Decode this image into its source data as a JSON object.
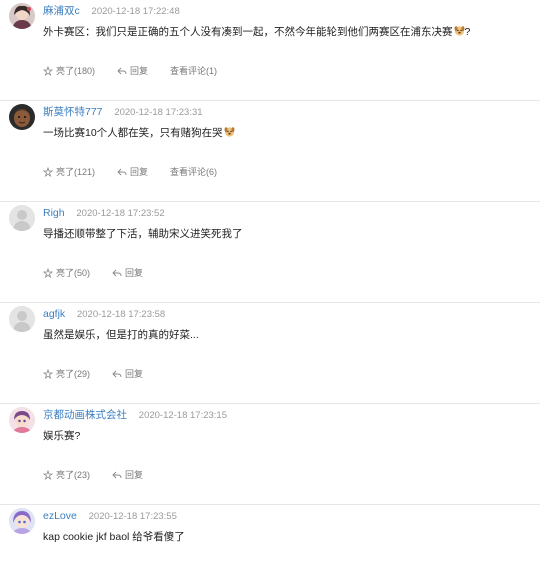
{
  "comments": [
    {
      "username": "麻浦双c",
      "time": "2020-12-18 17:22:48",
      "text": "外卡赛区：我们只是正确的五个人没有凑到一起，不然今年能轮到他们两赛区在浦东决赛",
      "suffix": "?",
      "emoji": true,
      "likes_label": "亮了(180)",
      "reply_label": "回复",
      "view_label": "查看评论(1)",
      "avatar": "girl-avatar"
    },
    {
      "username": "斯莫怀特777",
      "time": "2020-12-18 17:23:31",
      "text": "一场比赛10个人都在笑，只有赌狗在哭",
      "suffix": "",
      "emoji": true,
      "likes_label": "亮了(121)",
      "reply_label": "回复",
      "view_label": "查看评论(6)",
      "avatar": "dark-face-avatar"
    },
    {
      "username": "Righ",
      "time": "2020-12-18 17:23:52",
      "text": "导播还顺带整了下活，辅助宋义进笑死我了",
      "suffix": "",
      "emoji": false,
      "likes_label": "亮了(50)",
      "reply_label": "回复",
      "view_label": "",
      "avatar": "default-avatar"
    },
    {
      "username": "agfjk",
      "time": "2020-12-18 17:23:58",
      "text": "虽然是娱乐，但是打的真的好菜...",
      "suffix": "",
      "emoji": false,
      "likes_label": "亮了(29)",
      "reply_label": "回复",
      "view_label": "",
      "avatar": "default-avatar"
    },
    {
      "username": "京都动画株式会社",
      "time": "2020-12-18 17:23:15",
      "text": "娱乐赛?",
      "suffix": "",
      "emoji": false,
      "likes_label": "亮了(23)",
      "reply_label": "回复",
      "view_label": "",
      "avatar": "anime-avatar"
    },
    {
      "username": "ezLove",
      "time": "2020-12-18 17:23:55",
      "text": "kap cookie jkf baol 给爷看傻了",
      "suffix": "",
      "emoji": false,
      "likes_label": "",
      "reply_label": "",
      "view_label": "",
      "avatar": "anime-girl-avatar"
    }
  ],
  "colors": {
    "username": "#3a7fc2",
    "timestamp": "#9a9a9a",
    "action": "#777777",
    "divider": "#e6e6e6"
  }
}
